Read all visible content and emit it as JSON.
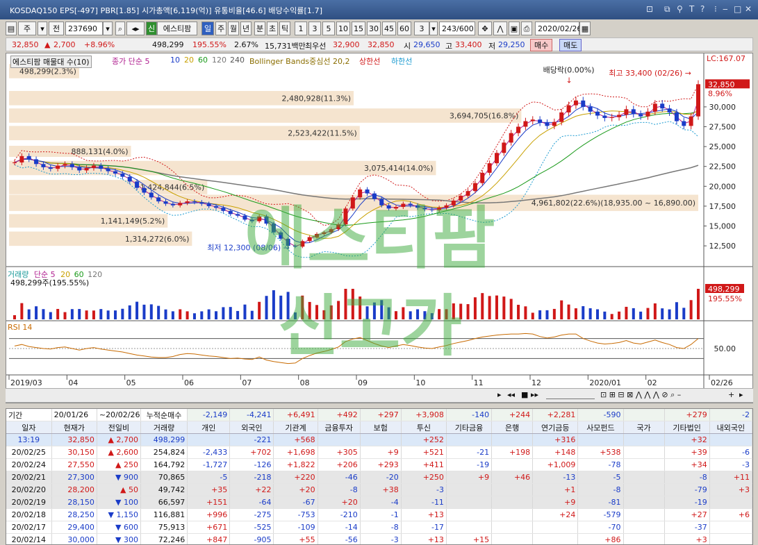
{
  "window": {
    "title": "KOSDAQ150 EPS[-497] PBR[1.85] 시가총액[6,119(억)] 유통비율[46.6] 배당수익률[1.7]"
  },
  "toolbar": {
    "period_ju": "주",
    "period_jeon": "전",
    "code": "237690",
    "name": "에스티팜",
    "badge_sin": "신",
    "periods": [
      "일",
      "주",
      "월",
      "년",
      "분",
      "초",
      "틱"
    ],
    "minutes": [
      "1",
      "3",
      "5",
      "10",
      "15",
      "30",
      "45",
      "60"
    ],
    "min_selected": "3",
    "count": "243/600",
    "date": "2020/02/26"
  },
  "quote": {
    "price": "32,850",
    "change": "2,700",
    "change_pct": "+8.96%",
    "volume": "498,299",
    "volume_pct": "195.55%",
    "turnover": "2.67%",
    "amount": "15,731백만",
    "label_best": "최우선",
    "ask": "32,900",
    "bid": "32,850",
    "open_label": "시",
    "open": "29,650",
    "high_label": "고",
    "high": "33,400",
    "low_label": "저",
    "low": "29,250",
    "buy": "매수",
    "sell": "매도"
  },
  "chart_data": {
    "type": "line",
    "title": "",
    "legend": {
      "main": "에스티팜 매물대 수(10)",
      "ma": "종가 단순 5",
      "ma_periods": [
        "10",
        "20",
        "60",
        "120",
        "240"
      ],
      "bb": "Bollinger Bands중심선 20,2",
      "bb_upper": "상한선",
      "bb_lower": "하한선"
    },
    "xticks": [
      "2019/03",
      "04",
      "05",
      "06",
      "07",
      "08",
      "09",
      "10",
      "11",
      "12",
      "2020/01",
      "02",
      "02/26"
    ],
    "yticks": [
      "30,000",
      "27,500",
      "25,000",
      "22,500",
      "20,000",
      "17,500",
      "15,000",
      "12,500"
    ],
    "ylim": [
      10500,
      35500
    ],
    "lc_label": "LC:167.07",
    "last_price": "32,850",
    "last_pct": "8.96%",
    "annotations": {
      "dividend": "배당락(0.00%)",
      "high": "최고 33,400 (02/26)",
      "low": "최저 12,300 (08/06)"
    },
    "volume_profile": [
      {
        "label": "498,299(2.3%)",
        "price_low": 33600,
        "price_high": 35400,
        "share": 2.3
      },
      {
        "label": "2,480,928(11.3%)",
        "price_low": 30200,
        "price_high": 32000,
        "share": 11.3
      },
      {
        "label": "3,694,705(16.8%)",
        "price_low": 28000,
        "price_high": 29800,
        "share": 16.8
      },
      {
        "label": "2,523,422(11.5%)",
        "price_low": 25800,
        "price_high": 27600,
        "share": 11.5
      },
      {
        "label": "888,131(4.0%)",
        "price_low": 23700,
        "price_high": 25100,
        "share": 4.0
      },
      {
        "label": "3,075,414(14.0%)",
        "price_low": 21400,
        "price_high": 23200,
        "share": 14.0
      },
      {
        "label": "1,424,844(6.5%)",
        "price_low": 19000,
        "price_high": 20800,
        "share": 6.5
      },
      {
        "label": "4,961,802(22.6%)(18,935.00 ~ 16,890.00)",
        "price_low": 16890,
        "price_high": 18935,
        "share": 22.6
      },
      {
        "label": "1,141,149(5.2%)",
        "price_low": 14800,
        "price_high": 16500,
        "share": 5.2
      },
      {
        "label": "1,314,272(6.0%)",
        "price_low": 12500,
        "price_high": 14300,
        "share": 6.0
      }
    ],
    "series": [
      {
        "name": "종가",
        "color": "#d01818",
        "values": [
          23000,
          23800,
          23400,
          22800,
          22400,
          22200,
          22600,
          22800,
          22400,
          22000,
          22300,
          22600,
          22200,
          21900,
          21600,
          21200,
          20600,
          19800,
          19200,
          18600,
          18100,
          17800,
          17600,
          17900,
          18100,
          18000,
          17800,
          17500,
          17300,
          16900,
          16500,
          16300,
          15800,
          15600,
          16200,
          15300,
          14200,
          13400,
          12500,
          12400,
          13100,
          13600,
          14000,
          14200,
          14600,
          15200,
          17200,
          18600,
          19600,
          19100,
          18400,
          17600,
          17200,
          17400,
          17800,
          17600,
          17300,
          17100,
          17000,
          17300,
          17600,
          18200,
          18800,
          19400,
          20400,
          21700,
          22900,
          24200,
          25500,
          26700,
          27500,
          28200,
          28400,
          28000,
          27600,
          28100,
          29300,
          30200,
          30800,
          30000,
          29400,
          28900,
          28600,
          28700,
          29000,
          29700,
          29100,
          28800,
          29400,
          30400,
          29800,
          29300,
          28200,
          27600,
          28800,
          32850
        ]
      }
    ],
    "volume_panel": {
      "label": "거래량",
      "ma": "단순 5",
      "ma_periods": [
        "20",
        "60",
        "120"
      ],
      "current": "498,299주(195.55%)",
      "last_value": "498,299",
      "last_pct": "195.55%"
    },
    "rsi_panel": {
      "label": "RSI 14",
      "ytick": "50.00",
      "values": [
        55,
        58,
        54,
        52,
        50,
        49,
        52,
        53,
        50,
        47,
        50,
        52,
        49,
        47,
        45,
        43,
        40,
        37,
        35,
        33,
        32,
        32,
        34,
        38,
        40,
        39,
        37,
        35,
        34,
        32,
        30,
        31,
        29,
        28,
        33,
        27,
        24,
        22,
        20,
        21,
        30,
        36,
        41,
        44,
        48,
        53,
        64,
        69,
        72,
        66,
        60,
        55,
        52,
        55,
        58,
        56,
        53,
        51,
        50,
        53,
        56,
        60,
        63,
        66,
        70,
        73,
        75,
        77,
        78,
        79,
        79,
        80,
        79,
        74,
        71,
        73,
        77,
        79,
        79,
        70,
        65,
        61,
        59,
        60,
        62,
        66,
        61,
        59,
        63,
        67,
        62,
        58,
        52,
        50,
        58,
        70
      ]
    }
  },
  "watermark": {
    "line1": "에스티팜",
    "line2": "신고가"
  },
  "table_header": {
    "period_label": "기간",
    "date_from": "20/01/26",
    "tilde": "~",
    "date_to": "20/02/26",
    "cum_label": "누적순매수",
    "cum": [
      "-2,149",
      "-4,241",
      "+6,491",
      "+492",
      "+297",
      "+3,908",
      "-140",
      "+244",
      "+2,281",
      "-590",
      "",
      "+279",
      "-2"
    ],
    "columns": [
      "일자",
      "현재가",
      "전일비",
      "거래량",
      "개인",
      "외국인",
      "기관계",
      "금융투자",
      "보험",
      "투신",
      "기타금융",
      "은행",
      "연기금등",
      "사모펀드",
      "국가",
      "기타법인",
      "내외국인"
    ]
  },
  "table_rows": [
    {
      "cls": "blue",
      "cells": [
        "13:19",
        "32,850",
        "▲ 2,700",
        "498,299",
        "",
        "-221",
        "+568",
        "",
        "",
        "+252",
        "",
        "",
        "+316",
        "",
        "",
        "+32",
        ""
      ]
    },
    {
      "cls": "",
      "cells": [
        "20/02/25",
        "30,150",
        "▲ 2,600",
        "254,824",
        "-2,433",
        "+702",
        "+1,698",
        "+305",
        "+9",
        "+521",
        "-21",
        "+198",
        "+148",
        "+538",
        "",
        "+39",
        "-6"
      ]
    },
    {
      "cls": "",
      "cells": [
        "20/02/24",
        "27,550",
        "▲ 250",
        "164,792",
        "-1,727",
        "-126",
        "+1,822",
        "+206",
        "+293",
        "+411",
        "-19",
        "",
        "+1,009",
        "-78",
        "",
        "+34",
        "-3"
      ]
    },
    {
      "cls": "gray",
      "cells": [
        "20/02/21",
        "27,300",
        "▼ 900",
        "70,865",
        "-5",
        "-218",
        "+220",
        "-46",
        "-20",
        "+250",
        "+9",
        "+46",
        "-13",
        "-5",
        "",
        "-8",
        "+11"
      ]
    },
    {
      "cls": "gray",
      "cells": [
        "20/02/20",
        "28,200",
        "▲ 50",
        "49,742",
        "+35",
        "+22",
        "+20",
        "-8",
        "+38",
        "-3",
        "",
        "",
        "+1",
        "-8",
        "",
        "-79",
        "+3"
      ]
    },
    {
      "cls": "gray",
      "cells": [
        "20/02/19",
        "28,150",
        "▼ 100",
        "66,597",
        "+151",
        "-64",
        "-67",
        "+20",
        "-4",
        "-11",
        "",
        "",
        "+9",
        "-81",
        "",
        "-19",
        ""
      ]
    },
    {
      "cls": "",
      "cells": [
        "20/02/18",
        "28,250",
        "▼ 1,150",
        "116,881",
        "+996",
        "-275",
        "-753",
        "-210",
        "-1",
        "+13",
        "",
        "",
        "+24",
        "-579",
        "",
        "+27",
        "+6"
      ]
    },
    {
      "cls": "",
      "cells": [
        "20/02/17",
        "29,400",
        "▼ 600",
        "75,913",
        "+671",
        "-525",
        "-109",
        "-14",
        "-8",
        "-17",
        "",
        "",
        "",
        "-70",
        "",
        "-37",
        ""
      ]
    },
    {
      "cls": "",
      "cells": [
        "20/02/14",
        "30,000",
        "▼ 300",
        "72,246",
        "+847",
        "-905",
        "+55",
        "-56",
        "-3",
        "+13",
        "+15",
        "",
        "",
        "+86",
        "",
        "+3",
        ""
      ]
    }
  ]
}
